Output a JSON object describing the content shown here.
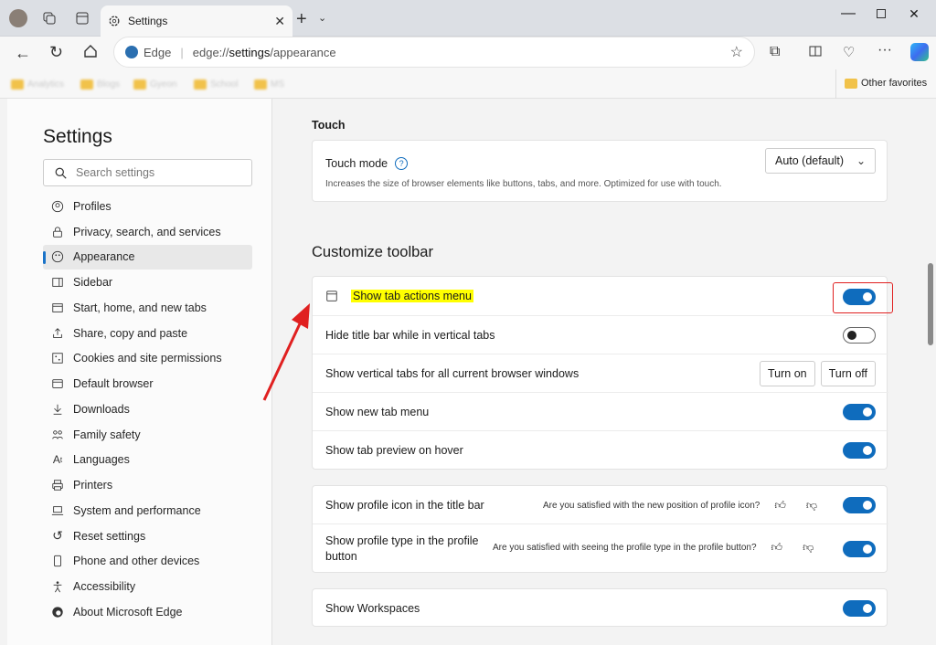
{
  "tabbar": {
    "tab_title": "Settings"
  },
  "address": {
    "site_label": "Edge",
    "url_prefix": "edge://",
    "url_bold": "settings",
    "url_suffix": "/appearance"
  },
  "favorites": {
    "other": "Other favorites"
  },
  "sidebar": {
    "title": "Settings",
    "search_placeholder": "Search settings",
    "items": [
      {
        "label": "Profiles",
        "icon": "profile-icon"
      },
      {
        "label": "Privacy, search, and services",
        "icon": "lock-icon"
      },
      {
        "label": "Appearance",
        "icon": "palette-icon"
      },
      {
        "label": "Sidebar",
        "icon": "sidebar-icon"
      },
      {
        "label": "Start, home, and new tabs",
        "icon": "home-icon"
      },
      {
        "label": "Share, copy and paste",
        "icon": "share-icon"
      },
      {
        "label": "Cookies and site permissions",
        "icon": "cookie-icon"
      },
      {
        "label": "Default browser",
        "icon": "browser-icon"
      },
      {
        "label": "Downloads",
        "icon": "download-icon"
      },
      {
        "label": "Family safety",
        "icon": "family-icon"
      },
      {
        "label": "Languages",
        "icon": "language-icon"
      },
      {
        "label": "Printers",
        "icon": "printer-icon"
      },
      {
        "label": "System and performance",
        "icon": "laptop-icon"
      },
      {
        "label": "Reset settings",
        "icon": "reset-icon"
      },
      {
        "label": "Phone and other devices",
        "icon": "phone-icon"
      },
      {
        "label": "Accessibility",
        "icon": "accessibility-icon"
      },
      {
        "label": "About Microsoft Edge",
        "icon": "edge-icon"
      }
    ]
  },
  "touch": {
    "section": "Touch",
    "mode_label": "Touch mode",
    "mode_desc": "Increases the size of browser elements like buttons, tabs, and more. Optimized for use with touch.",
    "mode_value": "Auto (default)"
  },
  "toolbar_section": {
    "title": "Customize toolbar",
    "rows": [
      {
        "label": "Show tab actions menu",
        "toggle": "on"
      },
      {
        "label": "Hide title bar while in vertical tabs",
        "toggle": "off"
      },
      {
        "label": "Show vertical tabs for all current browser windows",
        "btn_on": "Turn on",
        "btn_off": "Turn off"
      },
      {
        "label": "Show new tab menu",
        "toggle": "on"
      },
      {
        "label": "Show tab preview on hover",
        "toggle": "on"
      }
    ]
  },
  "profile_section": {
    "rows": [
      {
        "label": "Show profile icon in the title bar",
        "survey": "Are you satisfied with the new position of profile icon?"
      },
      {
        "label_line1": "Show profile type in the profile",
        "label_line2": "button",
        "survey": "Are you satisfied with seeing the profile type in the profile button?"
      }
    ]
  },
  "workspaces": {
    "label": "Show Workspaces"
  },
  "colors": {
    "accent": "#0f6cbd",
    "highlight": "#ffff00",
    "annotation_red": "#e02020"
  }
}
